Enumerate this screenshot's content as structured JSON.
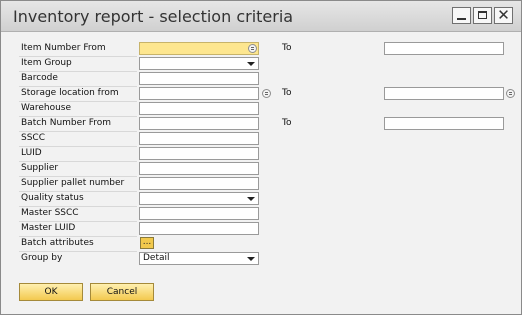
{
  "window": {
    "title": "Inventory report - selection criteria"
  },
  "form": {
    "item_number_from": {
      "label": "Item Number From",
      "value": ""
    },
    "item_number_to": {
      "label": "To",
      "value": ""
    },
    "item_group": {
      "label": "Item Group",
      "value": ""
    },
    "barcode": {
      "label": "Barcode",
      "value": ""
    },
    "storage_location_from": {
      "label": "Storage location from",
      "value": ""
    },
    "storage_location_to": {
      "label": "To",
      "value": ""
    },
    "warehouse": {
      "label": "Warehouse",
      "value": ""
    },
    "batch_number_from": {
      "label": "Batch Number From",
      "value": ""
    },
    "batch_number_to": {
      "label": "To",
      "value": ""
    },
    "sscc": {
      "label": "SSCC",
      "value": ""
    },
    "luid": {
      "label": "LUID",
      "value": ""
    },
    "supplier": {
      "label": "Supplier",
      "value": ""
    },
    "supplier_pallet_number": {
      "label": "Supplier pallet number",
      "value": ""
    },
    "quality_status": {
      "label": "Quality status",
      "value": ""
    },
    "master_sscc": {
      "label": "Master SSCC",
      "value": ""
    },
    "master_luid": {
      "label": "Master LUID",
      "value": ""
    },
    "batch_attributes": {
      "label": "Batch attributes",
      "button": "..."
    },
    "group_by": {
      "label": "Group by",
      "value": "Detail"
    }
  },
  "buttons": {
    "ok": "OK",
    "cancel": "Cancel"
  }
}
